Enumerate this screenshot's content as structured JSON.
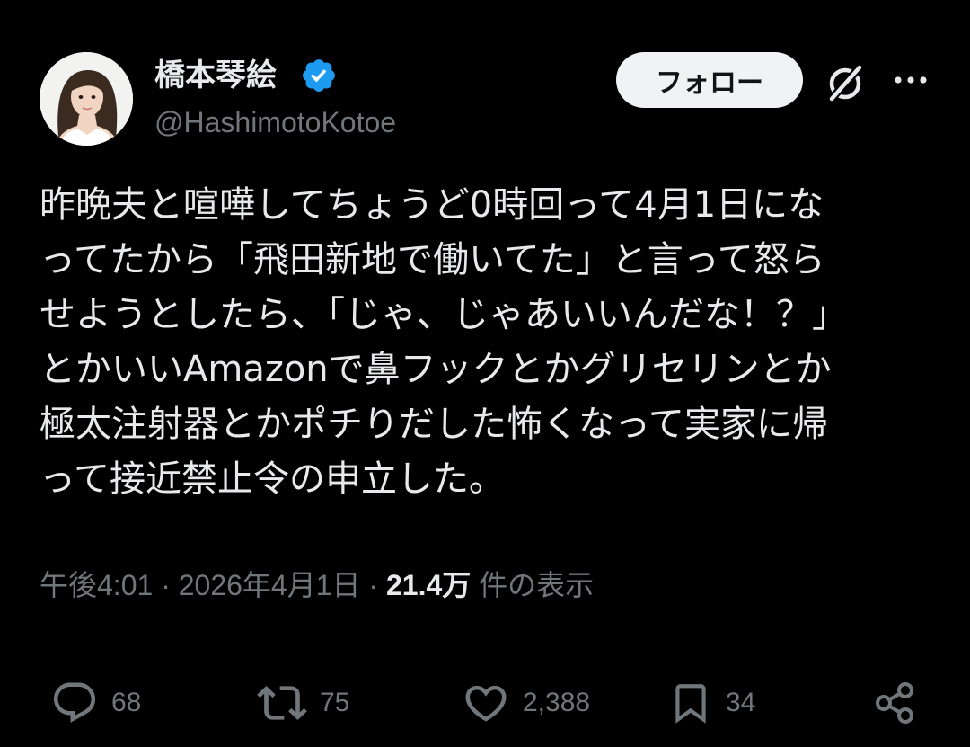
{
  "user": {
    "display_name": "橋本琴絵",
    "handle": "@HashimotoKotoe",
    "verified": true
  },
  "header": {
    "follow_label": "フォロー",
    "grok_icon": "grok-icon",
    "more_icon": "more-options-icon"
  },
  "tweet": {
    "text_lines": [
      "昨晩夫と喧嘩してちょうど0時回って4月1日にな",
      "ってたから「飛田新地で働いてた」と言って怒ら",
      "せようとしたら、「じゃ、じゃあいいんだな！？」",
      "とかいいAmazonで鼻フックとかグリセリンとか",
      "極太注射器とかポチりだした怖くなって実家に帰",
      "って接近禁止令の申立した。"
    ]
  },
  "meta": {
    "time": "午後4:01",
    "separator": "·",
    "date": "2026年4月1日",
    "views_count": "21.4万",
    "views_label": "件の表示"
  },
  "actions": {
    "replies": "68",
    "reposts": "75",
    "likes": "2,388",
    "bookmarks": "34"
  },
  "colors": {
    "background": "#000000",
    "text_primary": "#e7e9ea",
    "text_secondary": "#71767b",
    "verified_badge": "#1d9bf0",
    "follow_button_bg": "#eff3f4",
    "divider": "#2f3336"
  }
}
